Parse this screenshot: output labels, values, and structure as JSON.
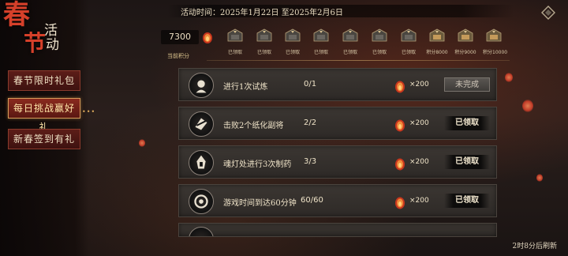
{
  "event": {
    "title_red_1": "春",
    "title_red_2": "节",
    "title_white_1": "活",
    "title_white_2": "动",
    "period": "活动时间：2025年1月22日 至2025年2月6日"
  },
  "menu": [
    {
      "label": "春节限时礼包",
      "active": false
    },
    {
      "label": "每日挑战赢好礼",
      "active": true
    },
    {
      "label": "新春签到有礼",
      "active": false
    }
  ],
  "points": {
    "value": "7300",
    "label": "当前积分"
  },
  "rewards": [
    {
      "label": "已领取"
    },
    {
      "label": "已领取"
    },
    {
      "label": "已领取"
    },
    {
      "label": "已领取"
    },
    {
      "label": "已领取"
    },
    {
      "label": "已领取"
    },
    {
      "label": "已领取"
    },
    {
      "label": "积分8000"
    },
    {
      "label": "积分9000"
    },
    {
      "label": "积分10000"
    }
  ],
  "tasks": [
    {
      "name": "进行1次试炼",
      "progress": "0/1",
      "reward_qty": "×200",
      "status": "未完成",
      "state": "incomplete",
      "icon": "trial-icon"
    },
    {
      "name": "击败2个纸化副将",
      "progress": "2/2",
      "reward_qty": "×200",
      "status": "已领取",
      "state": "claimed",
      "icon": "slash-icon"
    },
    {
      "name": "魂灯处进行3次制药",
      "progress": "3/3",
      "reward_qty": "×200",
      "status": "已领取",
      "state": "claimed",
      "icon": "lantern-icon"
    },
    {
      "name": "游戏时间到达60分钟",
      "progress": "60/60",
      "reward_qty": "×200",
      "status": "已领取",
      "state": "claimed",
      "icon": "clock-icon"
    }
  ],
  "refresh": "2时8分后刷新",
  "colors": {
    "accent_red": "#d6402a",
    "gold": "#d9a75a",
    "panel": "#332e2b"
  }
}
